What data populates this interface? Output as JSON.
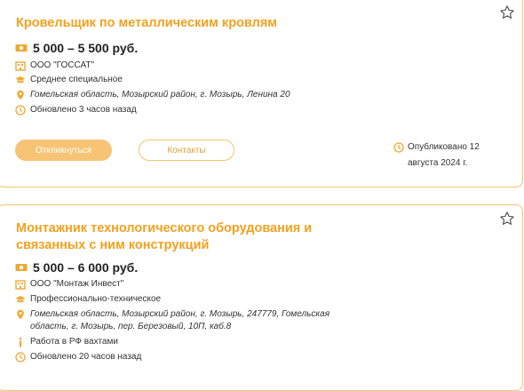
{
  "vacancies": [
    {
      "title": "Кровельщик по металлическим кровлям",
      "salary": "5 000 – 5 500 руб.",
      "company": "ООО \"ГОССАТ\"",
      "education": "Среднее специальное",
      "address": "Гомельская область, Мозырский район, г. Мозырь, Ленина 20",
      "updated": "Обновлено 3 часов назад",
      "respond_label": "Откликнуться",
      "contacts_label": "Контакты",
      "published": "Опубликовано 12 августа 2024 г."
    },
    {
      "title": "Монтажник технологического оборудования и связанных с ним конструкций",
      "salary": "5 000 – 6 000 руб.",
      "company": "ООО \"Монтаж Инвест\"",
      "education": "Профессионально-техническое",
      "address": "Гомельская область, Мозырский район, г. Мозырь, 247779, Гомельская область, г. Мозырь, пер. Березовый, 10П, каб.8",
      "work_info": "Работа в РФ вахтами",
      "updated": "Обновлено 20 часов назад"
    }
  ],
  "colors": {
    "accent": "#f2a11e",
    "icon": "#f0a830",
    "button_fill": "#f7c476",
    "border": "#f0c76a"
  },
  "icons": [
    "banknote-icon",
    "building-icon",
    "graduation-cap-icon",
    "map-pin-icon",
    "clock-icon",
    "info-icon",
    "star-icon"
  ]
}
